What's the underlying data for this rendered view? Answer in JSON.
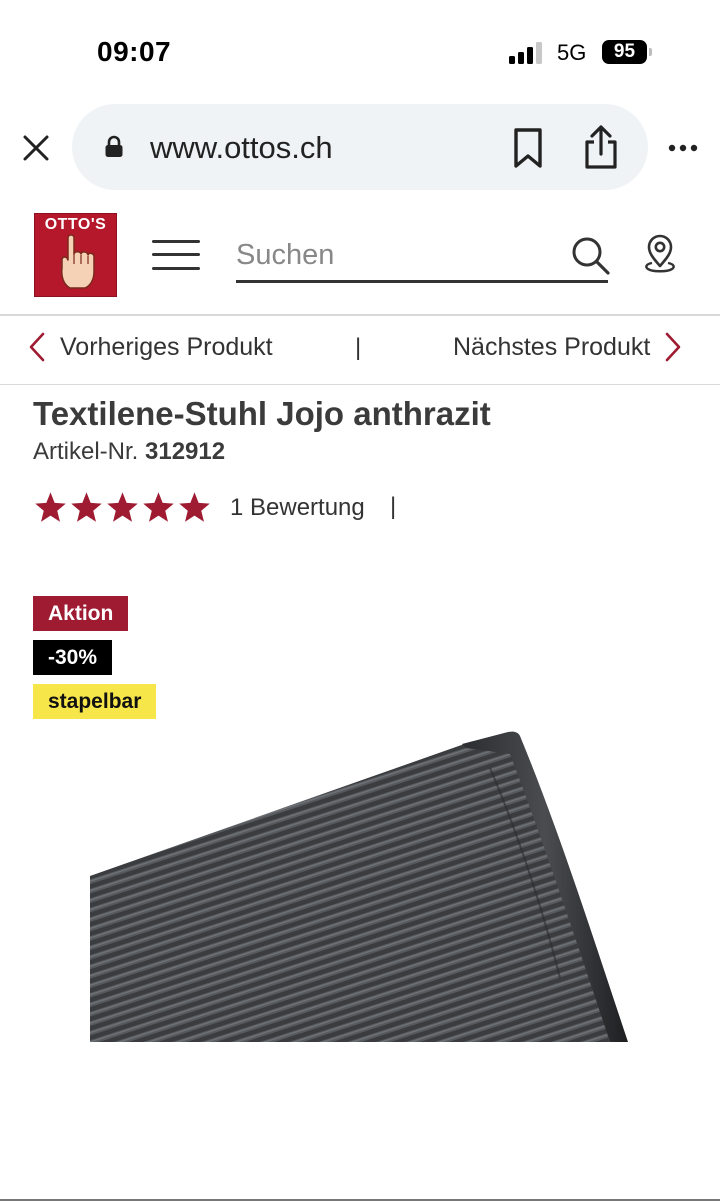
{
  "status_bar": {
    "time": "09:07",
    "network": "5G",
    "battery": "95"
  },
  "browser": {
    "url": "www.ottos.ch",
    "icons": [
      "close-icon",
      "lock-icon",
      "bookmark-icon",
      "share-icon",
      "more-icon"
    ]
  },
  "header": {
    "logo_text": "OTTO'S",
    "search_placeholder": "Suchen",
    "icons": [
      "hamburger-menu-icon",
      "search-icon",
      "location-pin-icon"
    ],
    "brand_color": "#b5182b"
  },
  "product_nav": {
    "prev_label": "Vorheriges Produkt",
    "separator": "|",
    "next_label": "Nächstes Produkt"
  },
  "product": {
    "title": "Textilene-Stuhl Jojo anthrazit",
    "article_label": "Artikel-Nr.",
    "article_number": "312912",
    "rating_stars": 5,
    "rating_max": 5,
    "rating_text": "1 Bewertung",
    "rating_separator": "|",
    "star_color": "#9e1b32",
    "badges": {
      "action": "Aktion",
      "discount": "-30%",
      "stackable": "stapelbar"
    },
    "badge_colors": {
      "action": "#9e1b32",
      "discount": "#000000",
      "stackable": "#f7e64a"
    }
  }
}
